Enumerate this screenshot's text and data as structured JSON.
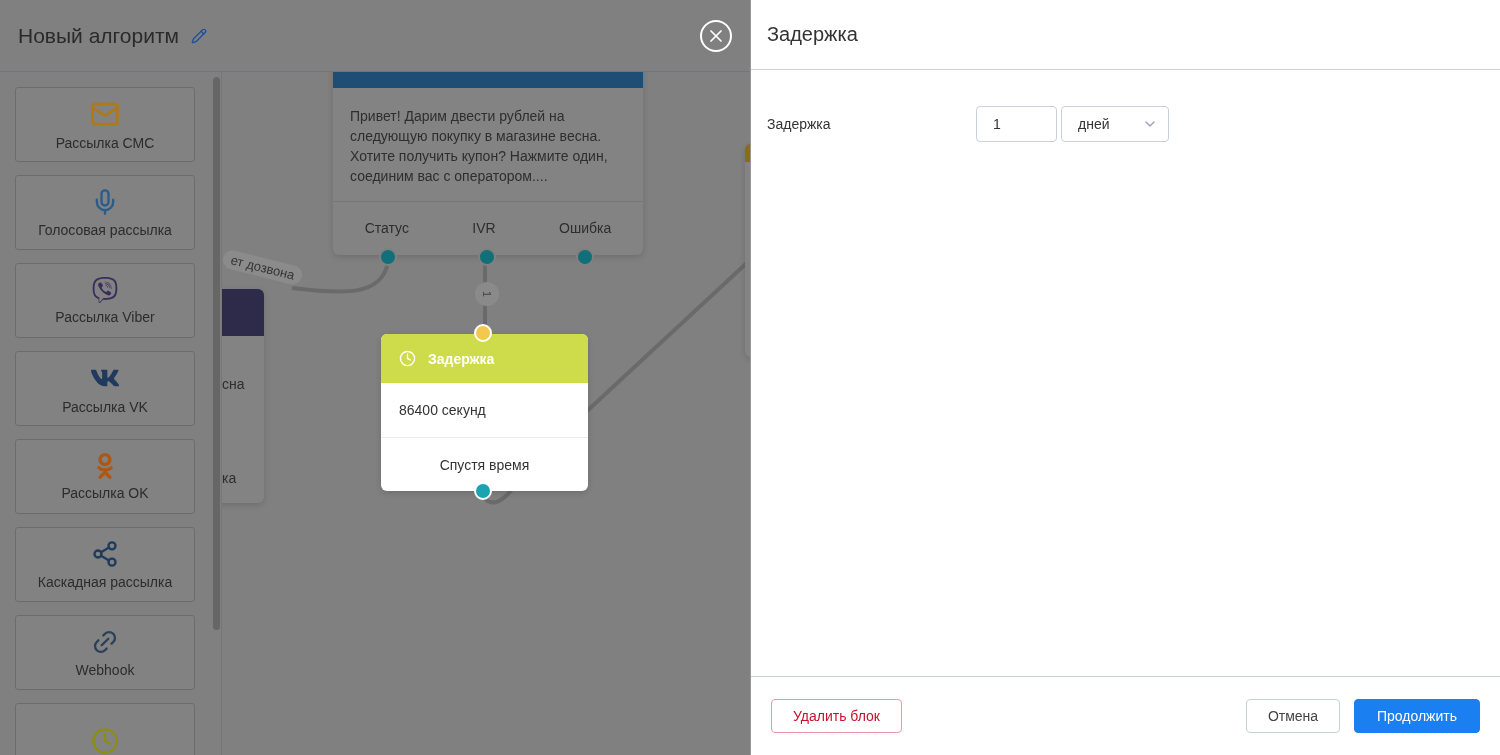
{
  "editor": {
    "title": "Новый алгоритм"
  },
  "palette": [
    {
      "label": "Рассылка СМС",
      "kind": "sms"
    },
    {
      "label": "Голосовая рассылка",
      "kind": "voice"
    },
    {
      "label": "Рассылка Viber",
      "kind": "viber"
    },
    {
      "label": "Рассылка VK",
      "kind": "vk"
    },
    {
      "label": "Рассылка OK",
      "kind": "ok"
    },
    {
      "label": "Каскадная рассылка",
      "kind": "cascade"
    },
    {
      "label": "Webhook",
      "kind": "webhook"
    },
    {
      "kind": "delay"
    }
  ],
  "canvas": {
    "message_node": {
      "text": "Привет! Дарим двести рублей на следующую покупку в магазине весна. Хотите получить купон? Нажмите один, соединим вас с оператором....",
      "outputs": [
        "Статус",
        "IVR",
        "Ошибка"
      ]
    },
    "edge_label": "ет дозвона",
    "edge_badge": "1",
    "partial_node": {
      "lines": [
        "сна",
        "ка"
      ]
    },
    "delay_node": {
      "title": "Задержка",
      "value": "86400 секунд",
      "output": "Спустя время"
    }
  },
  "panel": {
    "title": "Задержка",
    "field_label": "Задержка",
    "amount": "1",
    "unit": "дней",
    "buttons": [
      {
        "label": "Удалить блок",
        "kind": "danger"
      },
      {
        "label": "Отмена",
        "kind": "secondary"
      },
      {
        "label": "Продолжить",
        "kind": "primary"
      }
    ]
  }
}
